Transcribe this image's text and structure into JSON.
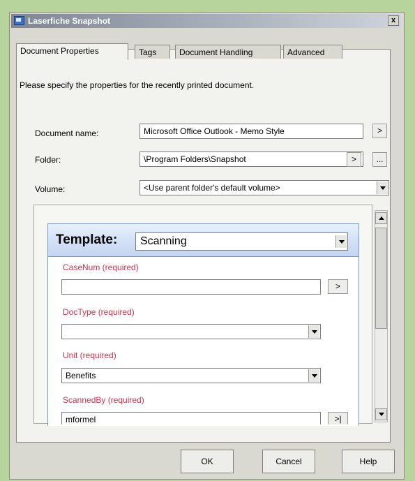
{
  "window": {
    "title": "Laserfiche Snapshot",
    "close_label": "x"
  },
  "tabs": [
    {
      "label": "Document Properties",
      "active": true
    },
    {
      "label": "Tags",
      "active": false
    },
    {
      "label": "Document Handling",
      "active": false
    },
    {
      "label": "Advanced",
      "active": false
    }
  ],
  "intro": "Please specify the properties for the recently printed document.",
  "document_name": {
    "label": "Document name:",
    "value": "Microsoft Office Outlook - Memo Style",
    "button": ">"
  },
  "folder": {
    "label": "Folder:",
    "value": "\\Program Folders\\Snapshot",
    "button": ">",
    "browse": "..."
  },
  "volume": {
    "label": "Volume:",
    "value": "<Use parent folder's default volume>"
  },
  "template": {
    "label": "Template:",
    "value": "Scanning",
    "fields": [
      {
        "label": "CaseNum (required)",
        "value": "",
        "button": ">"
      },
      {
        "label": "DocType (required)",
        "value": ""
      },
      {
        "label": "Unit (required)",
        "value": "Benefits"
      },
      {
        "label": "ScannedBy (required)",
        "value": "mformel",
        "button": ">|"
      }
    ]
  },
  "footer": {
    "ok": "OK",
    "cancel": "Cancel",
    "help": "Help"
  },
  "colors": {
    "required_label": "#d0324a",
    "template_header": "#c3d5f1",
    "background": "#b7d49c"
  },
  "icons": {
    "title": "laserfiche-app-icon",
    "dropdown": "chevron-down-icon"
  }
}
